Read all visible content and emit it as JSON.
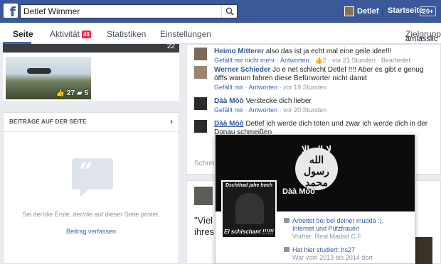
{
  "topbar": {
    "search_value": "Detlef Wimmer",
    "profile_name": "Detlef",
    "home_label": "Startseite",
    "home_badge": "20+"
  },
  "tabs": [
    {
      "label": "Seite",
      "active": true
    },
    {
      "label": "Aktivität",
      "badge": "46"
    },
    {
      "label": "Statistiken"
    },
    {
      "label": "Einstellungen"
    },
    {
      "label": "Zielgruppe"
    }
  ],
  "left": {
    "photo_top_count": "22",
    "photo_likes": "27",
    "photo_comments": "5",
    "panel_title": "BEITRÄGE AUF DER SEITE",
    "empty_text": "Sei der/die Erste, der/die auf dieser Seite postet.",
    "write_link": "Beitrag verfassen"
  },
  "comments": [
    {
      "name": "Heimo Mitterer",
      "text": "also das ist ja echt mal eine geile idee!!!",
      "meta_like": "Gefällt mir nicht mehr",
      "meta_reply": "Antworten",
      "meta_count": "2",
      "meta_time": "vor 21 Stunden",
      "meta_edit": "Bearbeitet"
    },
    {
      "name": "Werner Schieder",
      "text": "Jo e net schlecht Detlef !!!! Aber es gibt e genug öfffs warum fahren diese Befürworter nicht damit",
      "meta_like": "Gefällt mir",
      "meta_reply": "Antworten",
      "meta_time": "vor 19 Stunden"
    },
    {
      "name": "Dàà Mòò",
      "text": "Verstecke dich lieber",
      "meta_like": "Gefällt mir",
      "meta_reply": "Antworten",
      "meta_time": "vor 20 Stunden"
    },
    {
      "name": "Dàà Mòò",
      "text": "Detlef ich werde dich töten und zwar ich werde dich in der Donau schmeißen"
    }
  ],
  "write_comment": "Schreib",
  "post2": {
    "text": "\"Viel S\nihres N",
    "text_right": "ämlasslic"
  },
  "hovercard": {
    "name": "Dàà Mòò",
    "flag_line1": "لا إله إلا الله",
    "flag_line2": "الله رسول محمد",
    "pic_top": "Dschihad jahe hoch",
    "pic_bottom": "El schischant !!!!!!",
    "work_title_1": "Arbeitet bei bei deiner mudda :),",
    "work_title_2": "Internet und Putzfrauen",
    "work_sub": "Vorher: Real Madrid C.F.",
    "edu_title": "Hat hier studiert: hs27",
    "edu_sub": "War vom 2013 bis 2014 dort"
  }
}
